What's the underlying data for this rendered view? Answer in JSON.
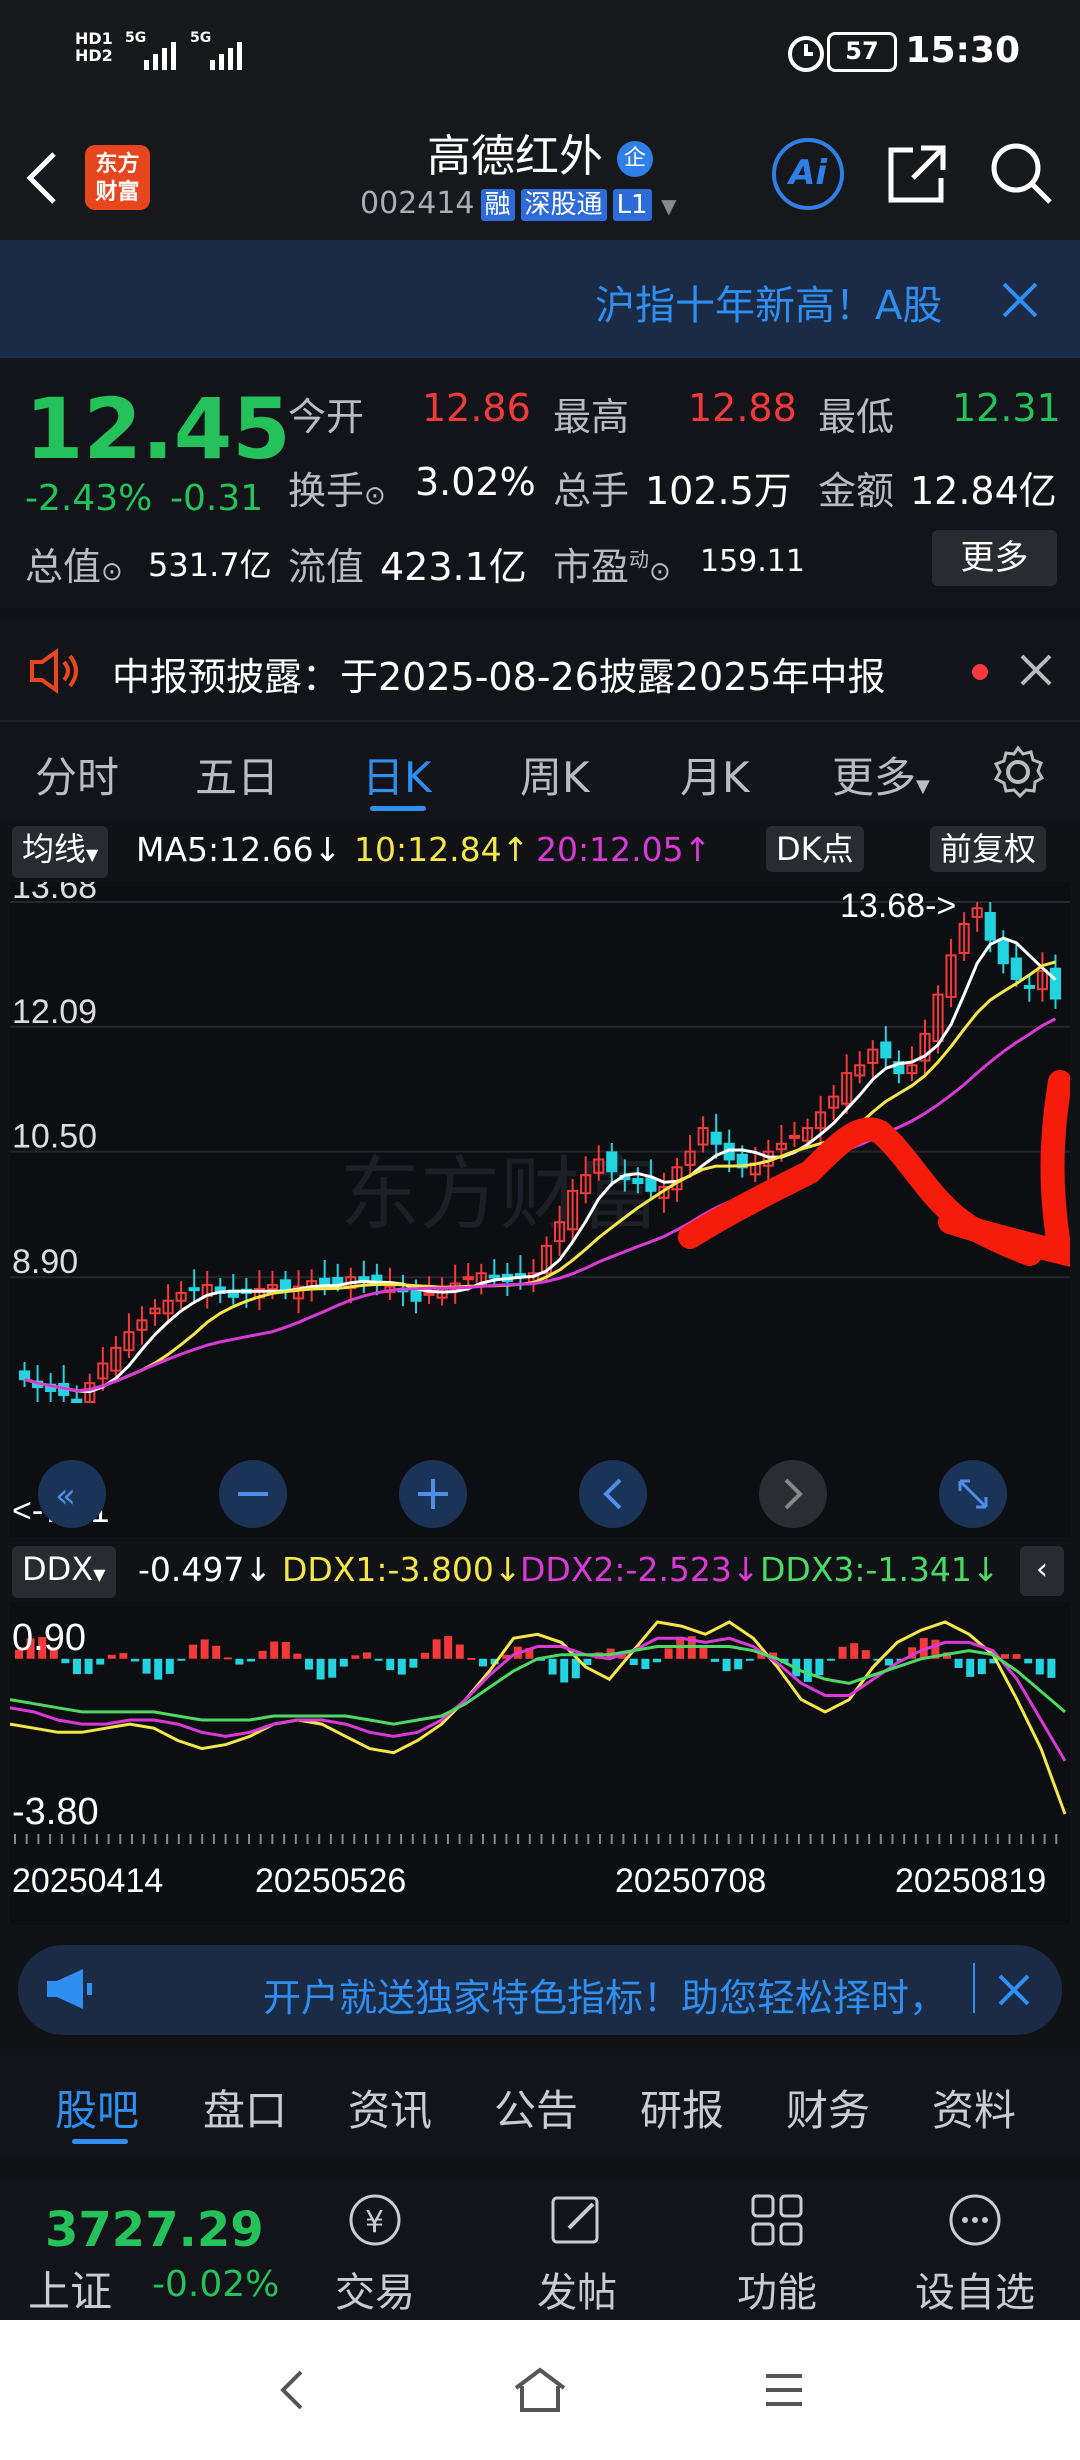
{
  "status": {
    "network_1": "HD1",
    "network_2": "HD2",
    "signal_1": "5G",
    "signal_2": "5G",
    "battery": "57",
    "time": "15:30"
  },
  "nav": {
    "logo_text": "东方\n财富",
    "stock_name": "高德红外",
    "stock_badge": "企",
    "code": "002414",
    "tags": [
      "融",
      "深股通",
      "L1"
    ],
    "ai_label": "Ai"
  },
  "banner": {
    "text": "沪指十年新高！A股"
  },
  "quote": {
    "price": "12.45",
    "change_pct": "-2.43%",
    "change": "-0.31",
    "open_label": "今开",
    "open": "12.86",
    "high_label": "最高",
    "high": "12.88",
    "low_label": "最低",
    "low": "12.31",
    "turnover_label": "换手",
    "turnover": "3.02%",
    "volume_label": "总手",
    "volume": "102.5万",
    "amount_label": "金额",
    "amount": "12.84亿",
    "mktcap_label": "总值",
    "mktcap": "531.7亿",
    "float_label": "流值",
    "float": "423.1亿",
    "pe_label": "市盈",
    "pe_sup": "动",
    "pe": "159.11",
    "more_label": "更多"
  },
  "notice": {
    "text": "中报预披露：于2025-08-26披露2025年中报"
  },
  "period_tabs": [
    "分时",
    "五日",
    "日K",
    "周K",
    "月K",
    "更多"
  ],
  "active_period": "日K",
  "indicators": {
    "ma_label": "均线",
    "ma5": "MA5:12.66↓",
    "ma10": "10:12.84↑",
    "ma20": "20:12.05↑",
    "dk_label": "DK点",
    "adjust_label": "前复权"
  },
  "ddx": {
    "label": "DDX",
    "ddx": "-0.497↓",
    "ddx1": "DDX1:-3.800↓",
    "ddx2": "DDX2:-2.523↓",
    "ddx3": "DDX3:-1.341↓",
    "y_top": "0.90",
    "y_bottom": "-3.80"
  },
  "colors": {
    "up": "#f23a3a",
    "down": "#22d3e0",
    "ma5": "#ffffff",
    "ma10": "#f5e64a",
    "ma20": "#d93ad6",
    "ddx3": "#4cd964",
    "accent": "#2f7fe8"
  },
  "chart_data": {
    "type": "candlestick",
    "y_ticks": [
      "13.68",
      "12.09",
      "10.50",
      "8.90"
    ],
    "ylim": [
      7.31,
      13.68
    ],
    "max_label": "13.68->",
    "min_label": "<-7.31",
    "x_labels": [
      "20250414",
      "20250526",
      "20250708",
      "20250819"
    ],
    "watermark": "东方财富",
    "closes": [
      7.6,
      7.5,
      7.45,
      7.4,
      7.31,
      7.55,
      7.8,
      8.0,
      8.2,
      8.35,
      8.5,
      8.6,
      8.7,
      8.75,
      8.8,
      8.7,
      8.65,
      8.7,
      8.75,
      8.8,
      8.72,
      8.78,
      8.85,
      8.8,
      8.82,
      8.9,
      8.86,
      8.8,
      8.78,
      8.72,
      8.6,
      8.7,
      8.75,
      8.82,
      8.9,
      8.95,
      8.9,
      8.85,
      8.9,
      8.95,
      9.3,
      9.6,
      10.0,
      10.2,
      10.4,
      10.25,
      10.15,
      10.1,
      10.0,
      10.05,
      10.3,
      10.5,
      10.8,
      10.6,
      10.4,
      10.3,
      10.35,
      10.5,
      10.6,
      10.7,
      10.8,
      11.0,
      11.2,
      11.5,
      11.6,
      11.8,
      11.7,
      11.5,
      11.6,
      12.0,
      12.5,
      13.0,
      13.4,
      13.6,
      13.2,
      12.9,
      12.7,
      12.6,
      12.8,
      12.45
    ],
    "ddx_series": {
      "ddx1": [
        -1.6,
        -1.7,
        -1.8,
        -1.8,
        -1.7,
        -1.6,
        -1.7,
        -2.0,
        -2.2,
        -2.1,
        -1.9,
        -1.6,
        -1.5,
        -1.6,
        -1.9,
        -2.2,
        -2.3,
        -2.0,
        -1.6,
        -1.0,
        -0.3,
        0.5,
        0.6,
        0.4,
        -0.2,
        -0.5,
        0.2,
        0.9,
        0.8,
        0.6,
        0.9,
        0.5,
        -0.2,
        -1.0,
        -1.3,
        -1.0,
        -0.2,
        0.4,
        0.7,
        0.9,
        0.6,
        0.1,
        -1.0,
        -2.2,
        -3.8
      ],
      "ddx2": [
        -1.2,
        -1.3,
        -1.5,
        -1.6,
        -1.6,
        -1.5,
        -1.5,
        -1.6,
        -1.8,
        -1.9,
        -1.8,
        -1.6,
        -1.5,
        -1.5,
        -1.6,
        -1.8,
        -1.9,
        -1.8,
        -1.5,
        -1.0,
        -0.4,
        0.1,
        0.3,
        0.3,
        0.1,
        0.0,
        0.2,
        0.5,
        0.5,
        0.4,
        0.5,
        0.3,
        -0.1,
        -0.6,
        -0.9,
        -0.9,
        -0.5,
        -0.1,
        0.2,
        0.4,
        0.4,
        0.2,
        -0.5,
        -1.5,
        -2.5
      ],
      "ddx3": [
        -1.0,
        -1.1,
        -1.2,
        -1.3,
        -1.3,
        -1.3,
        -1.3,
        -1.4,
        -1.5,
        -1.5,
        -1.5,
        -1.4,
        -1.4,
        -1.4,
        -1.4,
        -1.5,
        -1.6,
        -1.5,
        -1.4,
        -1.1,
        -0.7,
        -0.3,
        0.0,
        0.1,
        0.1,
        0.1,
        0.2,
        0.3,
        0.3,
        0.3,
        0.3,
        0.2,
        0.0,
        -0.3,
        -0.5,
        -0.6,
        -0.4,
        -0.2,
        0.0,
        0.1,
        0.2,
        0.1,
        -0.3,
        -0.8,
        -1.3
      ]
    }
  },
  "promo": {
    "text": "开户就送独家特色指标！助您轻松择时，"
  },
  "bottom_tabs": [
    "股吧",
    "盘口",
    "资讯",
    "公告",
    "研报",
    "财务",
    "资料"
  ],
  "active_bottom_tab": "股吧",
  "footer": {
    "index_value": "3727.29",
    "index_name": "上证",
    "index_change": "-0.02%",
    "buttons": [
      "交易",
      "发帖",
      "功能",
      "设自选"
    ]
  }
}
